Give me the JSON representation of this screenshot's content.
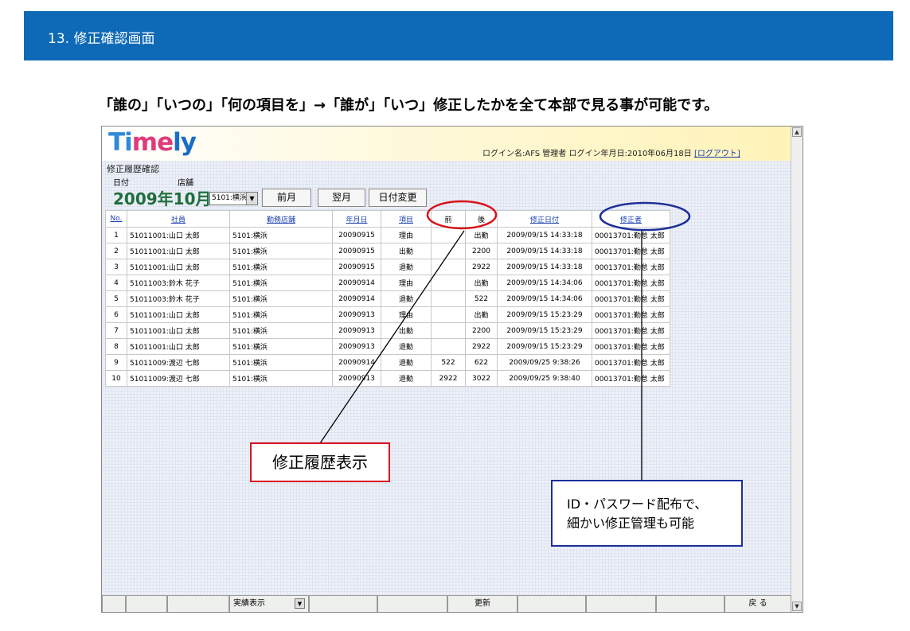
{
  "slide": {
    "header": "13. 修正確認画面",
    "subtitle": "「誰の」「いつの」「何の項目を」→「誰が」「いつ」修正したかを全て本部で見る事が可能です。"
  },
  "app": {
    "logo": {
      "t": "T",
      "i": "i",
      "m": "m",
      "e": "e",
      "ly": "ly"
    },
    "login_info": "ログイン名:AFS 管理者 ログイン年月日:2010年06月18日",
    "logout_label": "[ログアウト]",
    "screen_title": "修正履歴確認",
    "date_label": "日付",
    "store_label": "店舗",
    "month": "2009年10月",
    "store_value": "5101:横浜",
    "buttons": {
      "prev": "前月",
      "next": "翌月",
      "change_date": "日付変更"
    }
  },
  "table": {
    "headers": [
      "No.",
      "社員",
      "勤務店舗",
      "年月日",
      "項目",
      "前",
      "後",
      "修正日付",
      "修正者"
    ],
    "rows": [
      [
        "1",
        "51011001:山口 太郎",
        "5101:横浜",
        "20090915",
        "理由",
        "",
        "出勤",
        "2009/09/15 14:33:18",
        "00013701:勤怠 太郎"
      ],
      [
        "2",
        "51011001:山口 太郎",
        "5101:横浜",
        "20090915",
        "出勤",
        "",
        "2200",
        "2009/09/15 14:33:18",
        "00013701:勤怠 太郎"
      ],
      [
        "3",
        "51011001:山口 太郎",
        "5101:横浜",
        "20090915",
        "退勤",
        "",
        "2922",
        "2009/09/15 14:33:18",
        "00013701:勤怠 太郎"
      ],
      [
        "4",
        "51011003:鈴木 花子",
        "5101:横浜",
        "20090914",
        "理由",
        "",
        "出勤",
        "2009/09/15 14:34:06",
        "00013701:勤怠 太郎"
      ],
      [
        "5",
        "51011003:鈴木 花子",
        "5101:横浜",
        "20090914",
        "退勤",
        "",
        "522",
        "2009/09/15 14:34:06",
        "00013701:勤怠 太郎"
      ],
      [
        "6",
        "51011001:山口 太郎",
        "5101:横浜",
        "20090913",
        "理由",
        "",
        "出勤",
        "2009/09/15 15:23:29",
        "00013701:勤怠 太郎"
      ],
      [
        "7",
        "51011001:山口 太郎",
        "5101:横浜",
        "20090913",
        "出勤",
        "",
        "2200",
        "2009/09/15 15:23:29",
        "00013701:勤怠 太郎"
      ],
      [
        "8",
        "51011001:山口 太郎",
        "5101:横浜",
        "20090913",
        "退勤",
        "",
        "2922",
        "2009/09/15 15:23:29",
        "00013701:勤怠 太郎"
      ],
      [
        "9",
        "51011009:渡辺 七郎",
        "5101:横浜",
        "20090914",
        "退勤",
        "522",
        "622",
        "2009/09/25 9:38:26",
        "00013701:勤怠 太郎"
      ],
      [
        "10",
        "51011009:渡辺 七郎",
        "5101:横浜",
        "20090913",
        "退勤",
        "2922",
        "3022",
        "2009/09/25 9:38:40",
        "00013701:勤怠 太郎"
      ]
    ]
  },
  "footer": {
    "view_select": "実績表示",
    "update": "更新",
    "back": "戻 る"
  },
  "callouts": {
    "history": "修正履歴表示",
    "id_line1": "ID・パスワード配布で、",
    "id_line2": "細かい修正管理も可能"
  },
  "colors": {
    "header_blue": "#0e6ab7",
    "red": "#d8131c",
    "navy": "#1c2f9a",
    "month_green": "#1f6e3a"
  }
}
